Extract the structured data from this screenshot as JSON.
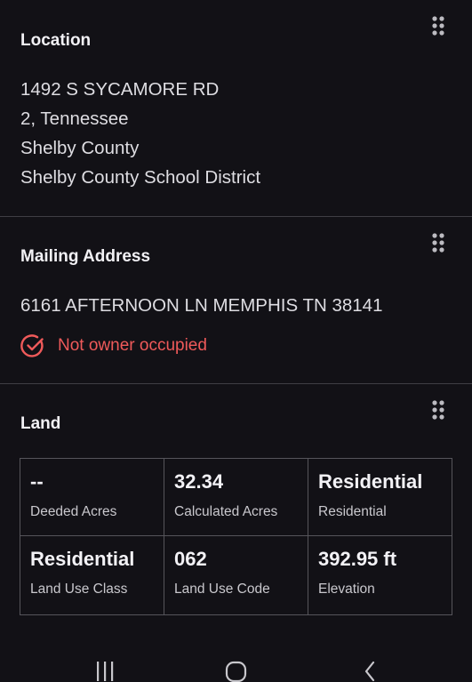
{
  "location": {
    "title": "Location",
    "lines": [
      "1492 S SYCAMORE RD",
      "2, Tennessee",
      "Shelby County",
      "Shelby County School District"
    ]
  },
  "mailing": {
    "title": "Mailing Address",
    "address": "6161 AFTERNOON LN MEMPHIS TN 38141",
    "status": "Not owner occupied",
    "status_color": "#ef5a5a",
    "status_icon": "circle-check-icon"
  },
  "land": {
    "title": "Land",
    "cells": [
      {
        "value": "--",
        "label": "Deeded Acres"
      },
      {
        "value": "32.34",
        "label": "Calculated Acres"
      },
      {
        "value": "Residential",
        "label": "Residential"
      },
      {
        "value": "Residential",
        "label": "Land Use Class"
      },
      {
        "value": "062",
        "label": "Land Use Code"
      },
      {
        "value": "392.95 ft",
        "label": "Elevation"
      }
    ]
  },
  "nav": {
    "items": [
      "recent-apps-icon",
      "home-icon",
      "back-icon"
    ]
  },
  "colors": {
    "background": "#121116",
    "divider": "#3f3e44",
    "text": "#e7e6ea",
    "accent_red": "#ef5a5a"
  }
}
